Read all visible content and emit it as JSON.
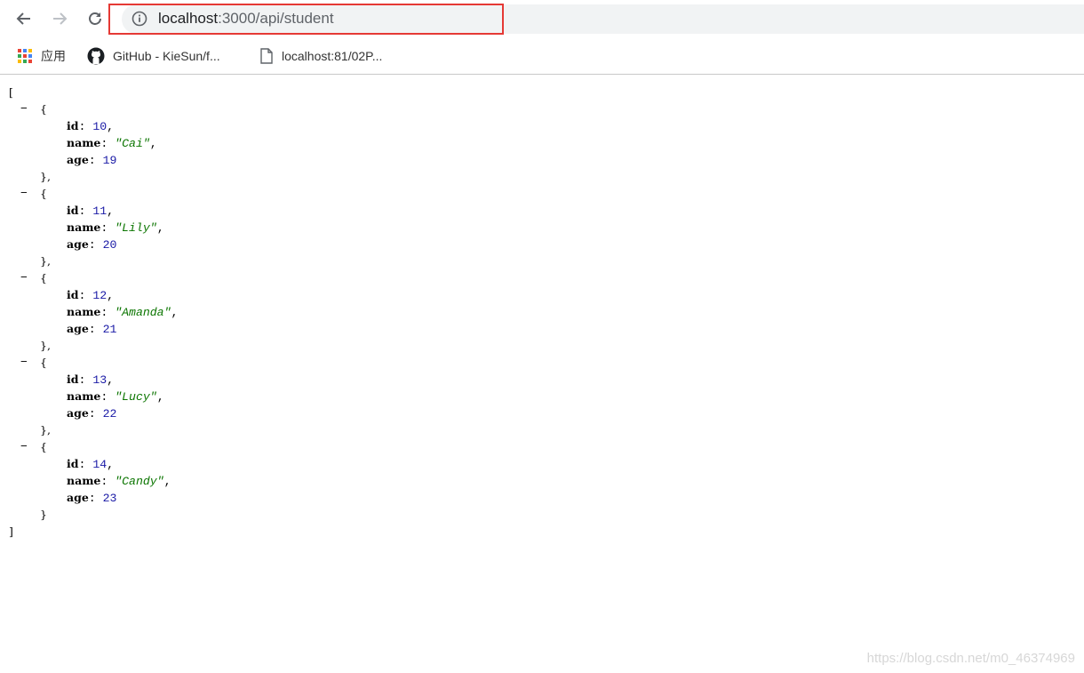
{
  "browser": {
    "url_host": "localhost",
    "url_rest": ":3000/api/student"
  },
  "bookmarks": [
    {
      "label": "应用",
      "icon": "apps-grid-icon"
    },
    {
      "label": "GitHub - KieSun/f...",
      "icon": "github-icon"
    },
    {
      "label": "localhost:81/02P...",
      "icon": "page-icon"
    }
  ],
  "json": {
    "open_bracket": "[",
    "close_bracket": "]",
    "collapse_symbol": "−",
    "items": [
      {
        "id": "10",
        "name": "\"Cai\"",
        "age": "19"
      },
      {
        "id": "11",
        "name": "\"Lily\"",
        "age": "20"
      },
      {
        "id": "12",
        "name": "\"Amanda\"",
        "age": "21"
      },
      {
        "id": "13",
        "name": "\"Lucy\"",
        "age": "22"
      },
      {
        "id": "14",
        "name": "\"Candy\"",
        "age": "23"
      }
    ],
    "keys": {
      "id": "id",
      "name": "name",
      "age": "age"
    }
  },
  "watermark": "https://blog.csdn.net/m0_46374969",
  "colors": {
    "highlight": "#e53935",
    "number": "#1a1aa6",
    "string": "#0b7500"
  }
}
